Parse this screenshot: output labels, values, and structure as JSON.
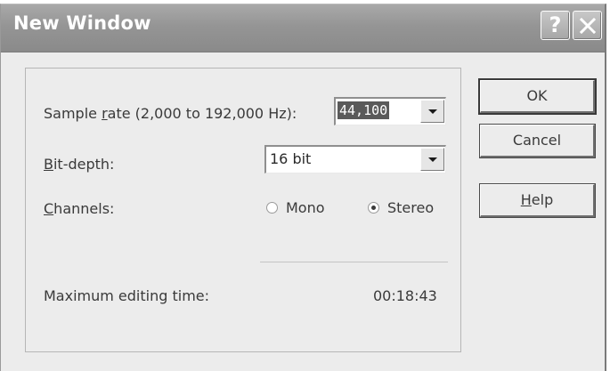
{
  "window": {
    "title": "New Window"
  },
  "titlebar": {
    "help_glyph": "?",
    "close_icon": "close-icon"
  },
  "form": {
    "sample_rate_label_pre": "Sample ",
    "sample_rate_label_u": "r",
    "sample_rate_label_post": "ate (2,000 to 192,000 Hz):",
    "sample_rate_value": "44,100",
    "bit_depth_label_u": "B",
    "bit_depth_label_post": "it-depth:",
    "bit_depth_value": "16 bit",
    "channels_label_u": "C",
    "channels_label_post": "hannels:",
    "channel_options": [
      {
        "label": "Mono",
        "selected": false
      },
      {
        "label": "Stereo",
        "selected": true
      }
    ],
    "max_editing_label": "Maximum editing time:",
    "max_editing_value": "00:18:43"
  },
  "buttons": {
    "ok": "OK",
    "cancel": "Cancel",
    "help_u": "H",
    "help_post": "elp"
  }
}
